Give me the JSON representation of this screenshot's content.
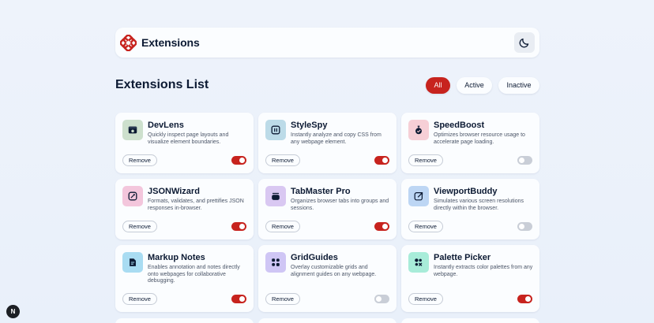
{
  "header": {
    "app_name": "Extensions"
  },
  "list": {
    "title": "Extensions List"
  },
  "filters": [
    {
      "label": "All",
      "active": true
    },
    {
      "label": "Active",
      "active": false
    },
    {
      "label": "Inactive",
      "active": false
    }
  ],
  "remove_label": "Remove",
  "extensions": [
    {
      "name": "DevLens",
      "description": "Quickly inspect page layouts and visualize element boundaries.",
      "enabled": true,
      "icon": "devlens-icon",
      "icon_bg": "#cde0cd"
    },
    {
      "name": "StyleSpy",
      "description": "Instantly analyze and copy CSS from any webpage element.",
      "enabled": true,
      "icon": "stylespy-icon",
      "icon_bg": "#bcdbe8"
    },
    {
      "name": "SpeedBoost",
      "description": "Optimizes browser resource usage to accelerate page loading.",
      "enabled": false,
      "icon": "speedboost-icon",
      "icon_bg": "#f6cfd6"
    },
    {
      "name": "JSONWizard",
      "description": "Formats, validates, and prettifies JSON responses in-browser.",
      "enabled": true,
      "icon": "jsonwizard-icon",
      "icon_bg": "#f3c6dc"
    },
    {
      "name": "TabMaster Pro",
      "description": "Organizes browser tabs into groups and sessions.",
      "enabled": true,
      "icon": "tabmaster-icon",
      "icon_bg": "#d9c8f2"
    },
    {
      "name": "ViewportBuddy",
      "description": "Simulates various screen resolutions directly within the browser.",
      "enabled": false,
      "icon": "viewportbuddy-icon",
      "icon_bg": "#bdd6f4"
    },
    {
      "name": "Markup Notes",
      "description": "Enables annotation and notes directly onto webpages for collaborative debugging.",
      "enabled": true,
      "icon": "markupnotes-icon",
      "icon_bg": "#a9dcf2"
    },
    {
      "name": "GridGuides",
      "description": "Overlay customizable grids and alignment guides on any webpage.",
      "enabled": false,
      "icon": "gridguides-icon",
      "icon_bg": "#cfc6f5"
    },
    {
      "name": "Palette Picker",
      "description": "Instantly extracts color palettes from any webpage.",
      "enabled": true,
      "icon": "palettepicker-icon",
      "icon_bg": "#a8ecd9"
    }
  ],
  "colors": {
    "accent": "#c7231e",
    "toggle_off": "#c9ced7",
    "background": "#eef3fb",
    "card": "#fbfdff"
  },
  "dev_badge": {
    "label": "N"
  }
}
